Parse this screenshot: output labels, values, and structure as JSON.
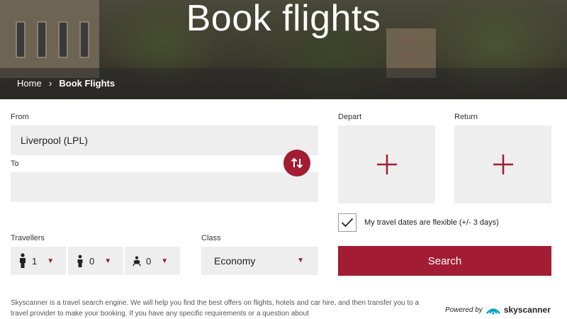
{
  "hero": {
    "title": "Book flights"
  },
  "breadcrumb": {
    "home": "Home",
    "separator": "›",
    "current": "Book Flights"
  },
  "form": {
    "from_label": "From",
    "from_value": "Liverpool (LPL)",
    "to_label": "To",
    "to_value": "",
    "depart_label": "Depart",
    "return_label": "Return",
    "flexible_label": "My travel dates are flexible (+/- 3 days)",
    "flexible_checked": true,
    "search_label": "Search",
    "travellers_label": "Travellers",
    "travellers": [
      {
        "icon": "adult-icon",
        "count": "1"
      },
      {
        "icon": "child-icon",
        "count": "0"
      },
      {
        "icon": "infant-icon",
        "count": "0"
      }
    ],
    "class_label": "Class",
    "class_value": "Economy"
  },
  "footer": {
    "text": "Skyscanner is a travel search engine. We will help you find the best offers on flights, hotels and car hire, and then transfer you to a travel provider to make your booking. If you have any specific requirements or a question about",
    "powered_by": "Powered by",
    "brand": "skyscanner"
  },
  "colors": {
    "accent": "#a21c33",
    "field_bg": "#eeeeee"
  }
}
